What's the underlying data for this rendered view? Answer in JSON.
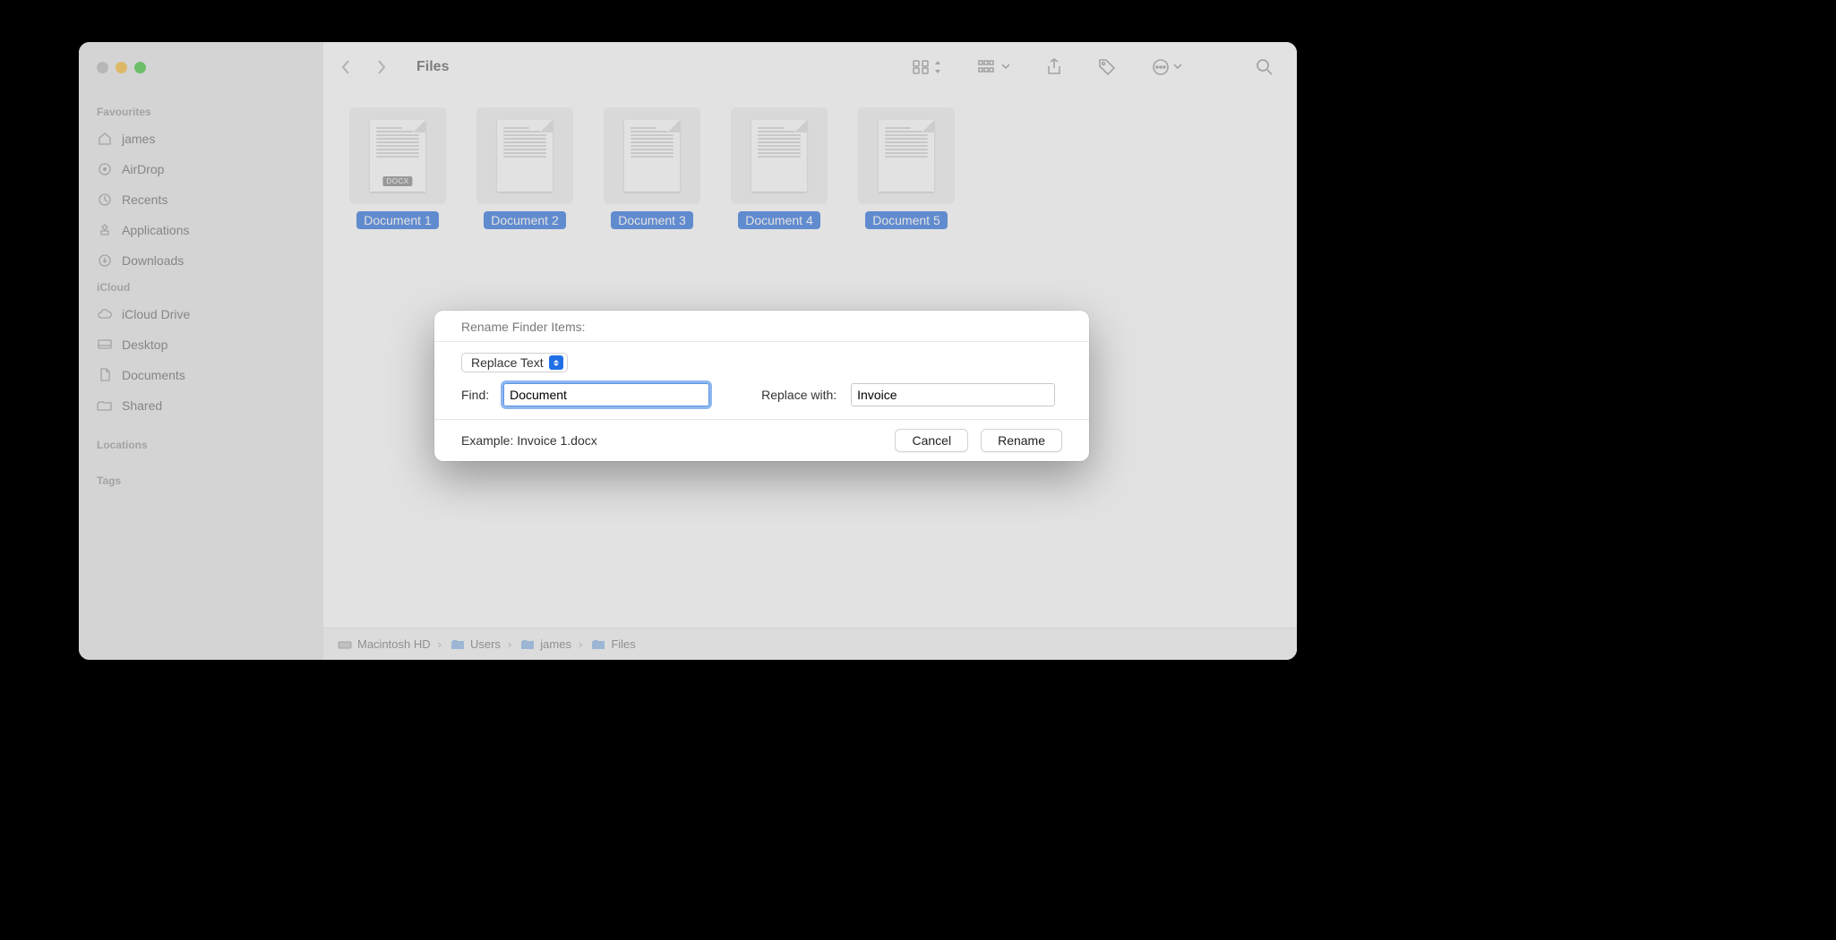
{
  "window": {
    "title": "Files",
    "traffic_lights": [
      "close",
      "minimize",
      "zoom"
    ]
  },
  "sidebar": {
    "sections": {
      "favourites": {
        "title": "Favourites",
        "items": [
          {
            "icon": "home-icon",
            "label": "james"
          },
          {
            "icon": "airdrop-icon",
            "label": "AirDrop"
          },
          {
            "icon": "clock-icon",
            "label": "Recents"
          },
          {
            "icon": "apps-icon",
            "label": "Applications"
          },
          {
            "icon": "download-icon",
            "label": "Downloads"
          }
        ]
      },
      "icloud": {
        "title": "iCloud",
        "items": [
          {
            "icon": "cloud-icon",
            "label": "iCloud Drive"
          },
          {
            "icon": "desktop-icon",
            "label": "Desktop"
          },
          {
            "icon": "documents-icon",
            "label": "Documents"
          },
          {
            "icon": "shared-icon",
            "label": "Shared"
          }
        ]
      },
      "locations": {
        "title": "Locations"
      },
      "tags": {
        "title": "Tags"
      }
    }
  },
  "toolbar": {
    "icons": [
      "grid-view",
      "group-by",
      "share",
      "tag",
      "more",
      "search"
    ]
  },
  "files": [
    {
      "name": "Document 1",
      "ext": "DOCX"
    },
    {
      "name": "Document 2",
      "ext": ""
    },
    {
      "name": "Document 3",
      "ext": ""
    },
    {
      "name": "Document 4",
      "ext": ""
    },
    {
      "name": "Document 5",
      "ext": ""
    }
  ],
  "pathbar": [
    {
      "icon": "disk",
      "label": "Macintosh HD"
    },
    {
      "icon": "folder",
      "label": "Users"
    },
    {
      "icon": "folder",
      "label": "james"
    },
    {
      "icon": "folder",
      "label": "Files"
    }
  ],
  "dialog": {
    "title": "Rename Finder Items:",
    "mode": "Replace Text",
    "find_label": "Find:",
    "find_value": "Document",
    "replace_label": "Replace with:",
    "replace_value": "Invoice",
    "example": "Example: Invoice 1.docx",
    "cancel": "Cancel",
    "confirm": "Rename"
  }
}
